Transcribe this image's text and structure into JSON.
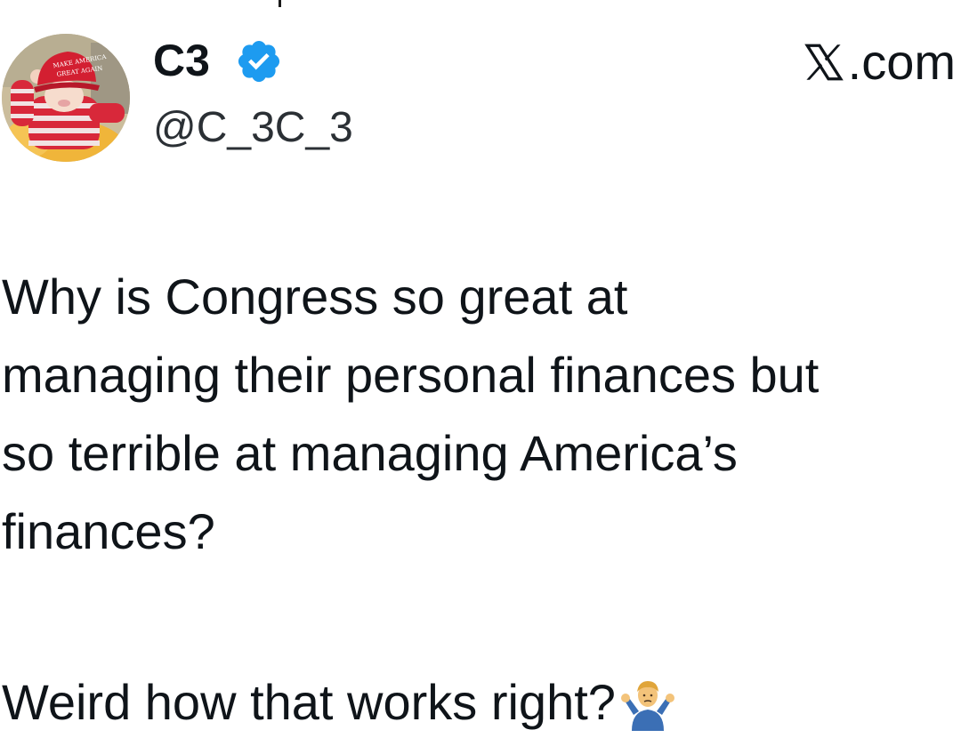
{
  "author": {
    "display_name": "C3",
    "handle": "@C_3C_3",
    "verified_icon": "verified-badge-icon",
    "avatar": "avatar-image"
  },
  "brand": {
    "label": ".com",
    "logo_icon": "x-logo-icon"
  },
  "tweet": {
    "text": "Why is Congress so great at\nmanaging their personal finances but\nso terrible at managing America’s\nfinances?",
    "followup": "Weird how that works right?",
    "emoji_icon": "person-shrugging-icon"
  },
  "colors": {
    "verified_blue": "#1d9bf0",
    "text": "#0f1419",
    "background": "#ffffff"
  }
}
